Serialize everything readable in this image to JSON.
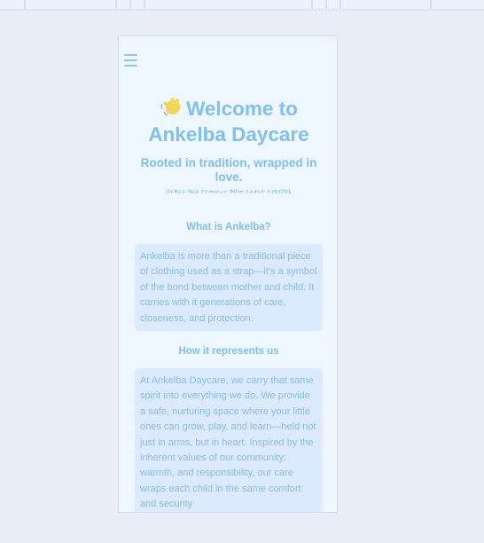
{
  "menu": {
    "icon": "hamburger-menu-icon"
  },
  "hero": {
    "emoji_icon": "waving-hand-icon",
    "title": "Welcome to Ankelba Daycare",
    "subtitle": "Rooted in tradition, wrapped in love.",
    "amharic": "በፍቅርና ባህል የተመሠረተ ቅድመ የሕፃናት እንክብካቤ"
  },
  "sections": [
    {
      "heading": "What is Ankelba?",
      "body": "Ankelba is more than a traditional piece of clothing used as a strap—it's a symbol of the bond between mother and child. It carries with it generations of care, closeness, and protection."
    },
    {
      "heading": "How it represents us",
      "body": "At Ankelba Daycare, we carry that same spirit into everything we do. We provide a safe, nurturing space where your little ones can grow, play, and learn—held not just in arms, but in heart. Inspired by the inherent values of our community: warmth, and responsibility, our care wraps each child in the same comfort and security"
    }
  ],
  "colors": {
    "page_background": "#e9edf7",
    "card_background": "#eef6ff",
    "accent": "#7fbff4",
    "section_box": "#dceaff"
  }
}
